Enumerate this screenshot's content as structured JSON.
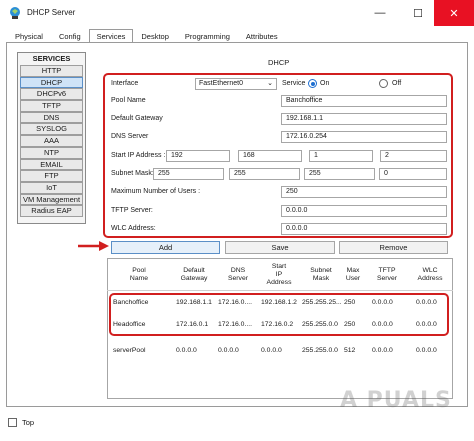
{
  "window": {
    "title": "DHCP Server",
    "minimize": "—",
    "maximize": "☐",
    "close": "✕"
  },
  "tabs": [
    "Physical",
    "Config",
    "Services",
    "Desktop",
    "Programming",
    "Attributes"
  ],
  "services": {
    "header": "SERVICES",
    "items": [
      "HTTP",
      "DHCP",
      "DHCPv6",
      "TFTP",
      "DNS",
      "SYSLOG",
      "AAA",
      "NTP",
      "EMAIL",
      "FTP",
      "IoT",
      "VM Management",
      "Radius EAP"
    ],
    "selected": "DHCP"
  },
  "dhcp": {
    "heading": "DHCP",
    "interface_label": "Interface",
    "interface_value": "FastEthernet0",
    "service_label": "Service",
    "on_label": "On",
    "off_label": "Off",
    "service_state": "On",
    "pool_name_label": "Pool Name",
    "pool_name": "Banchoffice",
    "gateway_label": "Default Gateway",
    "gateway": "192.168.1.1",
    "dns_label": "DNS Server",
    "dns": "172.16.0.254",
    "start_ip_label": "Start IP Address :",
    "start_ip": [
      "192",
      "168",
      "1",
      "2"
    ],
    "subnet_label": "Subnet Mask:",
    "subnet": [
      "255",
      "255",
      "255",
      "0"
    ],
    "max_users_label": "Maximum Number of Users :",
    "max_users": "250",
    "tftp_label": "TFTP Server:",
    "tftp": "0.0.0.0",
    "wlc_label": "WLC Address:",
    "wlc": "0.0.0.0"
  },
  "buttons": {
    "add": "Add",
    "save": "Save",
    "remove": "Remove"
  },
  "table": {
    "headers": [
      "Pool\nName",
      "Default\nGateway",
      "DNS\nServer",
      "Start\nIP\nAddress",
      "Subnet\nMask",
      "Max\nUser",
      "TFTP\nServer",
      "WLC\nAddress"
    ],
    "rows": [
      [
        "Banchoffice",
        "192.168.1.1",
        "172.16.0....",
        "192.168.1.2",
        "255.255.25...",
        "250",
        "0.0.0.0",
        "0.0.0.0"
      ],
      [
        "Headoffice",
        "172.16.0.1",
        "172.16.0....",
        "172.16.0.2",
        "255.255.0.0",
        "250",
        "0.0.0.0",
        "0.0.0.0"
      ],
      [
        "serverPool",
        "0.0.0.0",
        "0.0.0.0",
        "0.0.0.0",
        "255.255.0.0",
        "512",
        "0.0.0.0",
        "0.0.0.0"
      ]
    ]
  },
  "footer": {
    "top_label": "Top"
  },
  "watermark": "A PUALS",
  "colors": {
    "highlight_red": "#d11f1f",
    "radio_blue": "#1f6fd1",
    "close_red": "#e81123"
  }
}
